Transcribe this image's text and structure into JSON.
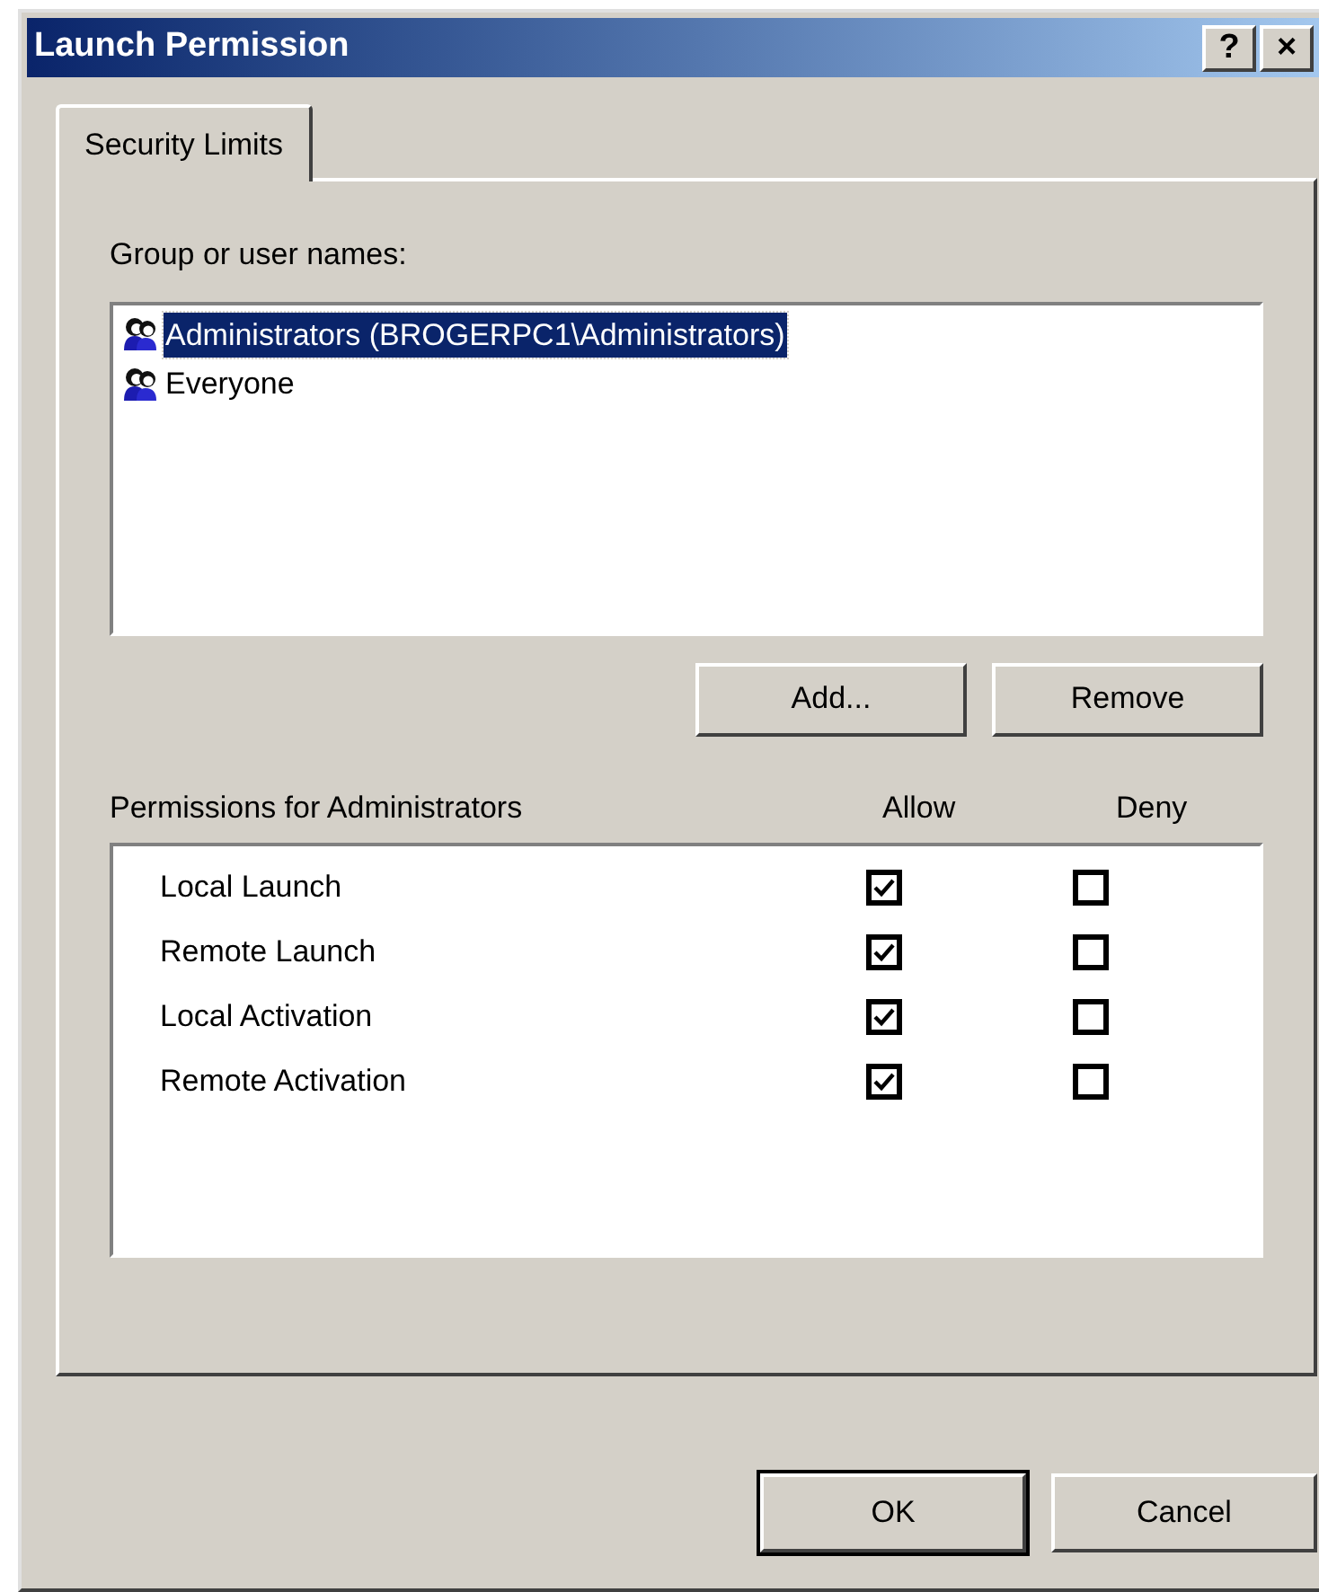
{
  "window": {
    "title": "Launch Permission",
    "title_buttons": [
      "?",
      "×"
    ]
  },
  "tabs": [
    {
      "label": "Security Limits",
      "selected": true
    }
  ],
  "group_list": {
    "label": "Group or user names:",
    "items": [
      {
        "name": "Administrators (BROGERPC1\\Administrators)",
        "selected": true
      },
      {
        "name": "Everyone",
        "selected": false
      }
    ]
  },
  "list_buttons": [
    "Add...",
    "Remove"
  ],
  "permissions": {
    "label": "Permissions for Administrators",
    "columns": [
      "Allow",
      "Deny"
    ],
    "rows": [
      {
        "name": "Local Launch",
        "allow": true,
        "deny": false
      },
      {
        "name": "Remote Launch",
        "allow": true,
        "deny": false
      },
      {
        "name": "Local Activation",
        "allow": true,
        "deny": false
      },
      {
        "name": "Remote Activation",
        "allow": true,
        "deny": false
      }
    ]
  },
  "dialog_buttons": [
    {
      "label": "OK",
      "default": true
    },
    {
      "label": "Cancel",
      "default": false
    }
  ]
}
